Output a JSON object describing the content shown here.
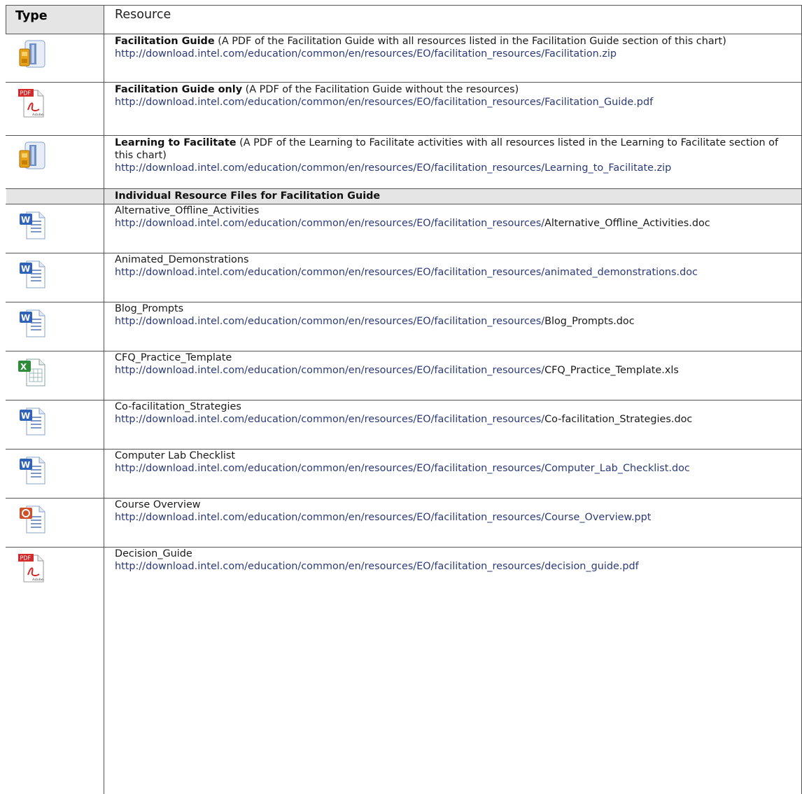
{
  "header": {
    "type": "Type",
    "resource": "Resource"
  },
  "rows": [
    {
      "icon": "zip-archive-icon",
      "title": "Facilitation Guide",
      "desc": " (A PDF of the Facilitation Guide with all resources listed in the Facilitation Guide section of this chart)",
      "url": "http://download.intel.com/education/common/en/resources/EO/facilitation_resources/Facilitation.zip"
    },
    {
      "icon": "pdf-document-icon",
      "title": "Facilitation Guide only",
      "desc": " (A PDF of the Facilitation Guide without the resources) ",
      "url": "http://download.intel.com/education/common/en/resources/EO/facilitation_resources/Facilitation_Guide.pdf"
    },
    {
      "icon": "zip-archive-icon",
      "title": "Learning to Facilitate",
      "desc": " (A PDF of the Learning to Facilitate activities with all resources listed in the Learning to Facilitate section of this chart)",
      "url": "http://download.intel.com/education/common/en/resources/EO/facilitation_resources/Learning_to_Facilitate.zip"
    }
  ],
  "section_title": "Individual Resource Files for Facilitation Guide",
  "files": [
    {
      "icon": "word-document-icon",
      "name": "Alternative_Offline_Activities",
      "url_base": "http://download.intel.com/education/common/en/resources/EO/facilitation_resources/",
      "file": "Alternative_Offline_Activities.doc"
    },
    {
      "icon": "word-document-icon",
      "name": "Animated_Demonstrations",
      "url_base": "http://download.intel.com/education/common/en/resources/EO/facilitation_resources/animated_demonstrations.doc",
      "file": ""
    },
    {
      "icon": "word-document-icon",
      "name": "Blog_Prompts",
      "url_base": "http://download.intel.com/education/common/en/resources/EO/facilitation_resources/",
      "file": "Blog_Prompts.doc"
    },
    {
      "icon": "excel-spreadsheet-icon",
      "name": "CFQ_Practice_Template",
      "url_base": "http://download.intel.com/education/common/en/resources/EO/facilitation_resources/",
      "file": "CFQ_Practice_Template.xls"
    },
    {
      "icon": "word-document-icon",
      "name": "Co-facilitation_Strategies",
      "url_base": "http://download.intel.com/education/common/en/resources/EO/facilitation_resources/",
      "file": "Co-facilitation_Strategies.doc"
    },
    {
      "icon": "word-document-icon",
      "name": "Computer Lab Checklist",
      "url_base": "http://download.intel.com/education/common/en/resources/EO/facilitation_resources/Computer_Lab_Checklist.doc",
      "file": ""
    },
    {
      "icon": "powerpoint-presentation-icon",
      "name": "Course Overview",
      "url_base": "http://download.intel.com/education/common/en/resources/EO/facilitation_resources/Course_Overview.ppt",
      "file": ""
    },
    {
      "icon": "pdf-document-icon",
      "name": "Decision_Guide",
      "url_base": "http://download.intel.com/education/common/en/resources/EO/facilitation_resources/decision_guide.pdf",
      "file": ""
    }
  ]
}
